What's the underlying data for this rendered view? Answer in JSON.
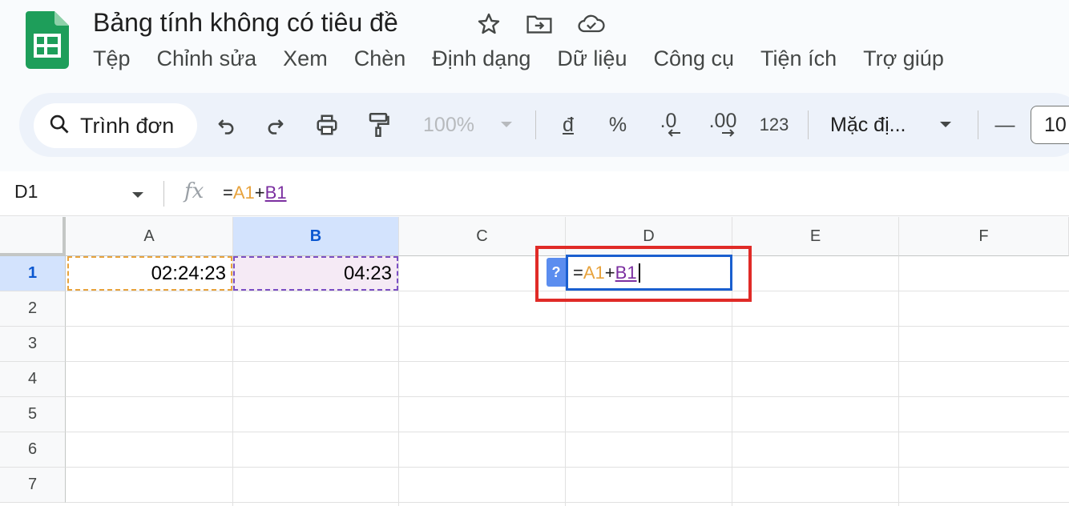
{
  "document": {
    "title": "Bảng tính không có tiêu đề"
  },
  "menu": [
    "Tệp",
    "Chỉnh sửa",
    "Xem",
    "Chèn",
    "Định dạng",
    "Dữ liệu",
    "Công cụ",
    "Tiện ích",
    "Trợ giúp"
  ],
  "toolbar": {
    "search_placeholder": "Trình đơn",
    "zoom": "100%",
    "currency": "đ",
    "percent": "%",
    "decrease_decimal": ".0",
    "increase_decimal": ".00",
    "number_format": "123",
    "font": "Mặc đị...",
    "font_size_minus": "—",
    "font_size": "10"
  },
  "formula_bar": {
    "name_box": "D1",
    "fx": "fx",
    "eq": "=",
    "ref1": "A1",
    "plus": "+",
    "ref2": "B1"
  },
  "grid": {
    "columns": [
      "A",
      "B",
      "C",
      "D",
      "E",
      "F"
    ],
    "selected_column": "B",
    "rows": [
      "1",
      "2",
      "3",
      "4",
      "5",
      "6",
      "7"
    ],
    "cells": {
      "A1": "02:24:23",
      "B1": "04:23"
    },
    "editor": {
      "help": "?",
      "eq": "=",
      "ref1": "A1",
      "plus": "+",
      "ref2": "B1"
    }
  },
  "colors": {
    "ref_a": "#e8a33d",
    "ref_b": "#7b2fa0",
    "highlight_frame": "#e02b27",
    "sheets_green": "#0f9d58"
  }
}
